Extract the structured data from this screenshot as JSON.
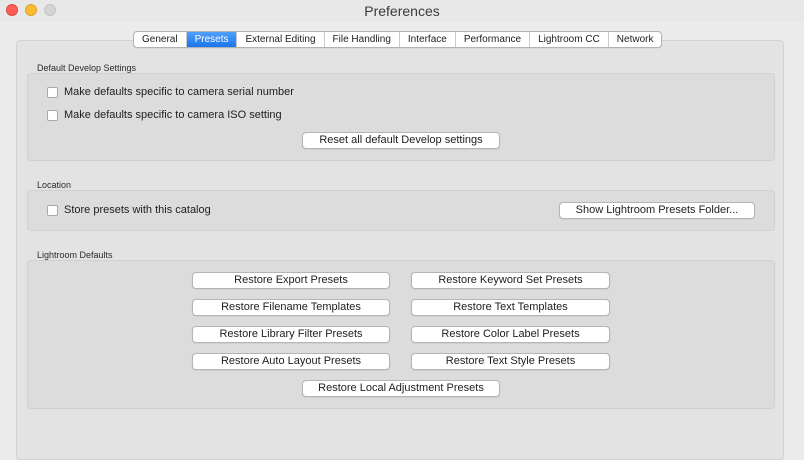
{
  "window": {
    "title": "Preferences"
  },
  "tabs": [
    {
      "label": "General"
    },
    {
      "label": "Presets",
      "selected": true
    },
    {
      "label": "External Editing"
    },
    {
      "label": "File Handling"
    },
    {
      "label": "Interface"
    },
    {
      "label": "Performance"
    },
    {
      "label": "Lightroom CC"
    },
    {
      "label": "Network"
    }
  ],
  "develop": {
    "label": "Default Develop Settings",
    "serial_checkbox": "Make defaults specific to camera serial number",
    "iso_checkbox": "Make defaults specific to camera ISO setting",
    "reset_button": "Reset all default Develop settings"
  },
  "location": {
    "label": "Location",
    "store_checkbox": "Store presets with this catalog",
    "show_folder_button": "Show Lightroom Presets Folder..."
  },
  "defaults": {
    "label": "Lightroom Defaults",
    "buttons": {
      "export": "Restore Export Presets",
      "keyword": "Restore Keyword Set Presets",
      "filename": "Restore Filename Templates",
      "text_templates": "Restore Text Templates",
      "library_filter": "Restore Library Filter Presets",
      "color_label": "Restore Color Label Presets",
      "auto_layout": "Restore Auto Layout Presets",
      "text_style": "Restore Text Style Presets",
      "local_adjustment": "Restore Local Adjustment Presets"
    }
  },
  "colors": {
    "accent": "#1b75ec",
    "close": "#fd5e57",
    "minimize": "#fdbb2e",
    "zoom_disabled": "#d4d4d4"
  }
}
